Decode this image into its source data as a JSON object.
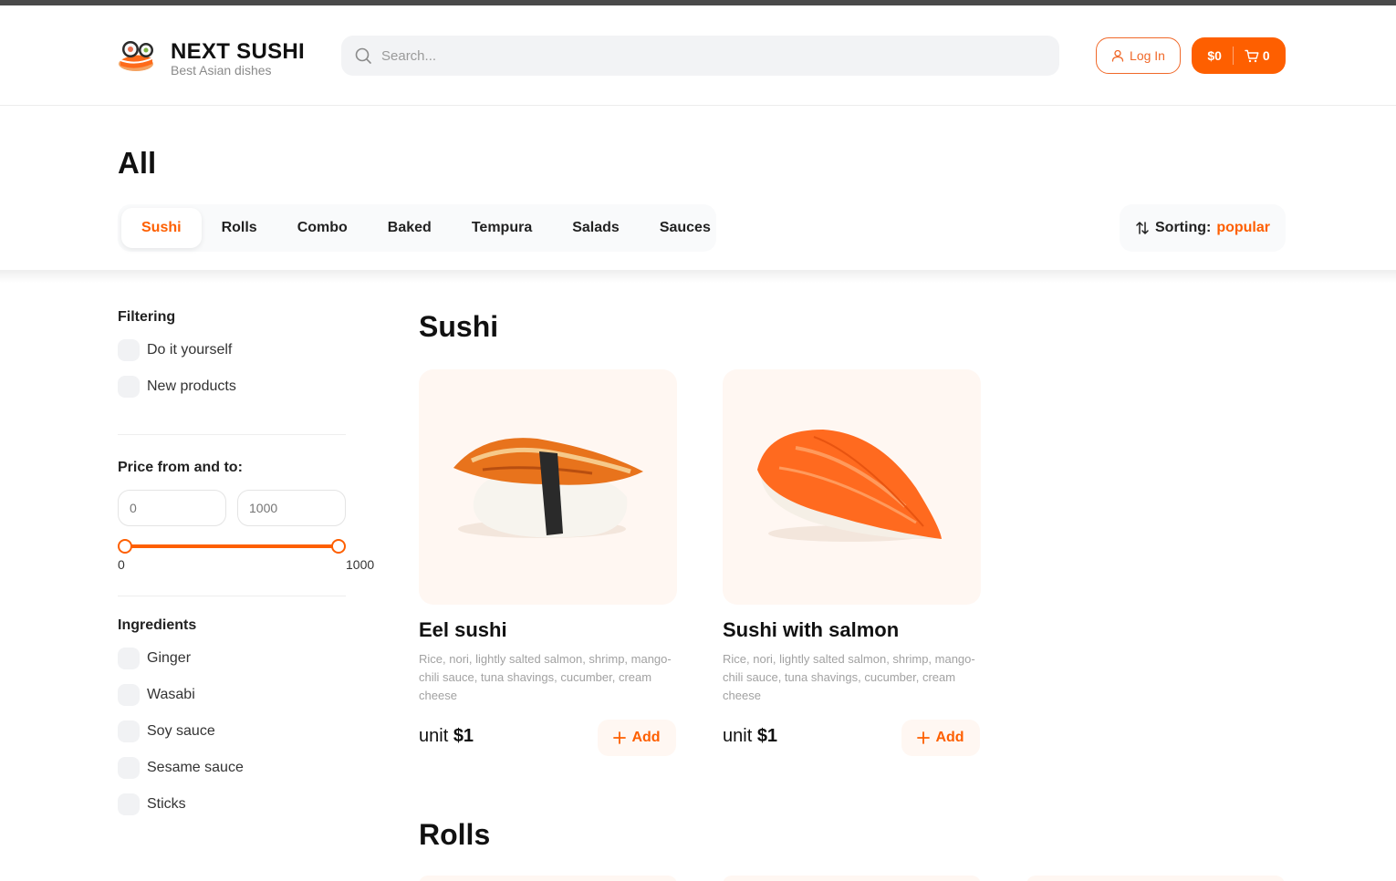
{
  "brand": {
    "title": "NEXT SUSHI",
    "subtitle": "Best Asian dishes"
  },
  "search": {
    "placeholder": "Search..."
  },
  "header": {
    "login_label": "Log In",
    "cart_total": "$0",
    "cart_count": "0"
  },
  "page_title": "All",
  "categories": [
    {
      "label": "Sushi",
      "active": true
    },
    {
      "label": "Rolls"
    },
    {
      "label": "Combo"
    },
    {
      "label": "Baked"
    },
    {
      "label": "Tempura"
    },
    {
      "label": "Salads"
    },
    {
      "label": "Sauces"
    }
  ],
  "sorting": {
    "label": "Sorting:",
    "value": "popular"
  },
  "filters": {
    "heading": "Filtering",
    "options": [
      "Do it yourself",
      "New products"
    ],
    "price_heading": "Price from and to:",
    "price_from": "0",
    "price_to": "1000",
    "slider_min_label": "0",
    "slider_max_label": "1000",
    "slider_range": [
      0,
      1000
    ],
    "ingredients_heading": "Ingredients",
    "ingredients": [
      "Ginger",
      "Wasabi",
      "Soy sauce",
      "Sesame sauce",
      "Sticks"
    ]
  },
  "sections": [
    {
      "title": "Sushi",
      "products": [
        {
          "name": "Eel sushi",
          "description": "Rice, nori, lightly salted salmon, shrimp, mango-chili sauce, tuna shavings, cucumber, cream cheese",
          "price_prefix": "unit",
          "price": "$1",
          "add_label": "Add"
        },
        {
          "name": "Sushi with salmon",
          "description": "Rice, nori, lightly salted salmon, shrimp, mango-chili sauce, tuna shavings, cucumber, cream cheese",
          "price_prefix": "unit",
          "price": "$1",
          "add_label": "Add"
        }
      ]
    },
    {
      "title": "Rolls",
      "products": []
    }
  ],
  "colors": {
    "accent": "#fe5f00",
    "card_bg": "#fff7f2",
    "muted": "#f1f2f4"
  },
  "icons": {
    "search": "search-icon",
    "user": "user-icon",
    "cart": "cart-icon",
    "sort": "sort-arrows-icon",
    "plus": "plus-icon"
  }
}
